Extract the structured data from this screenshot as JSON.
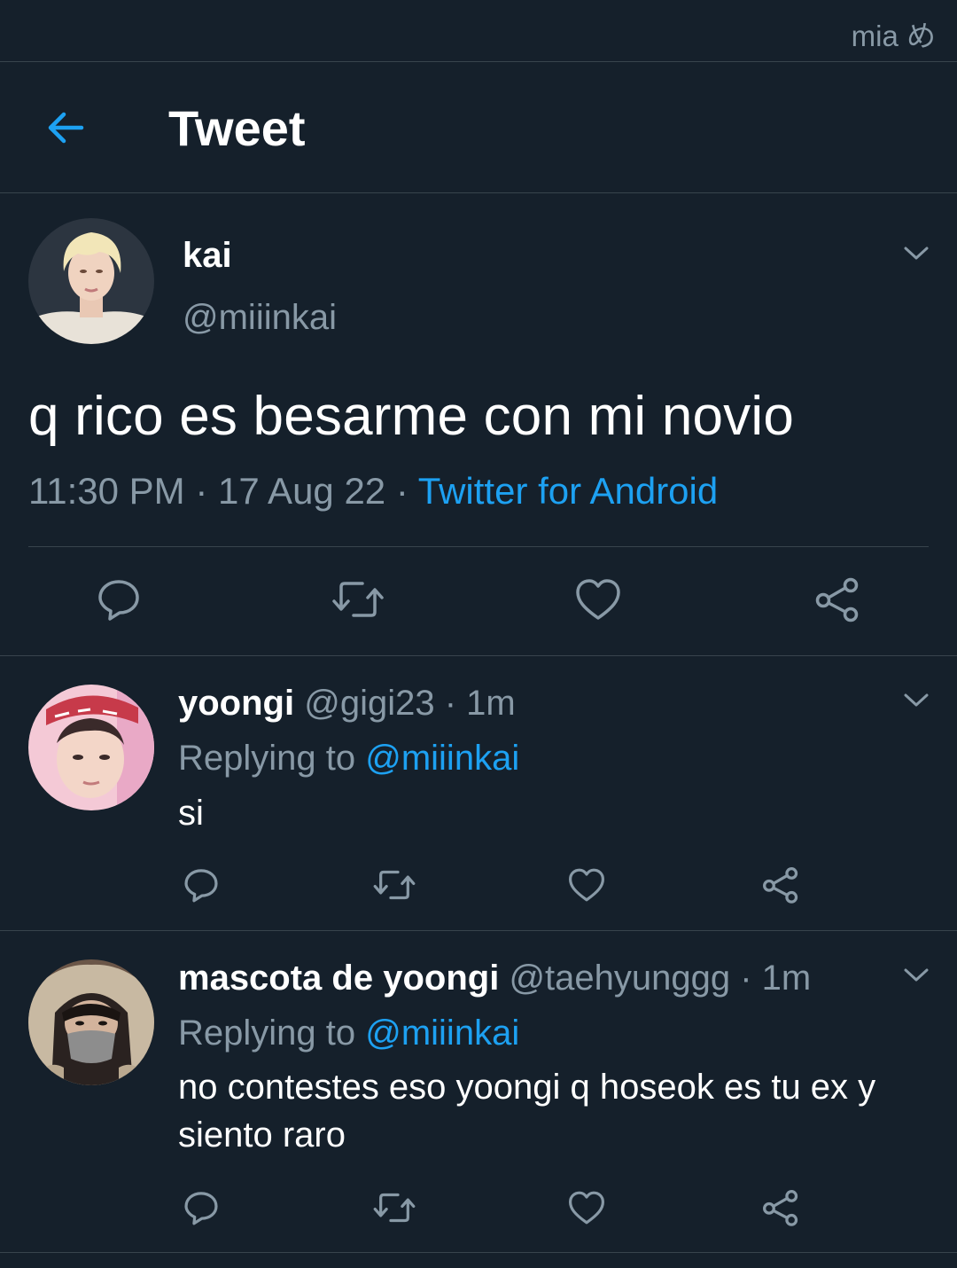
{
  "watermark": "mia め",
  "header": {
    "title": "Tweet",
    "back_icon": "arrow-left-icon"
  },
  "colors": {
    "background": "#15202b",
    "accent": "#1da1f2",
    "secondary_text": "#8899a6",
    "divider": "#38444d"
  },
  "tweet": {
    "name": "kai",
    "handle": "@miiinkai",
    "text": "q rico es besarme con mi novio",
    "time": "11:30 PM",
    "sep1": " · ",
    "date": "17 Aug 22",
    "sep2": " · ",
    "source": "Twitter for Android",
    "actions": [
      "reply-icon",
      "retweet-icon",
      "like-icon",
      "share-icon"
    ]
  },
  "replies": [
    {
      "name": "yoongi",
      "handle": "@gigi23",
      "age": " · 1m",
      "replying_label": "Replying to ",
      "replying_handle": "@miiinkai",
      "text": "si"
    },
    {
      "name": "mascota de yoongi",
      "handle": "@taehyunggg",
      "age": " · 1m",
      "replying_label": "Replying to ",
      "replying_handle": "@miiinkai",
      "text": "no contestes eso yoongi q hoseok es tu ex y siento raro"
    }
  ]
}
